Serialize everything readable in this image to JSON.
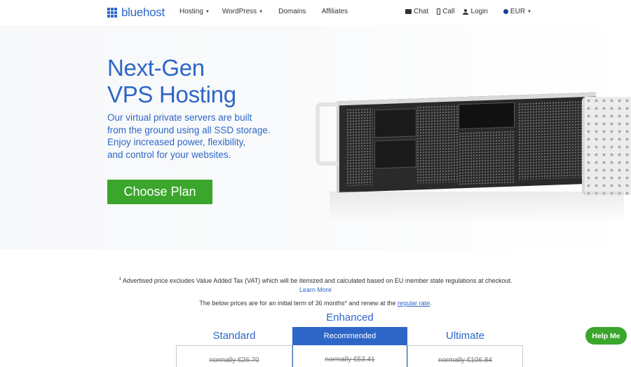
{
  "header": {
    "logo_text": "bluehost",
    "nav": [
      {
        "label": "Hosting",
        "dropdown": true
      },
      {
        "label": "WordPress",
        "dropdown": true
      },
      {
        "label": "Domains",
        "dropdown": false
      },
      {
        "label": "Affiliates",
        "dropdown": false
      }
    ],
    "right": {
      "chat": "Chat",
      "call": "Call",
      "login": "Login",
      "currency": "EUR"
    }
  },
  "hero": {
    "title_line1": "Next-Gen",
    "title_line2": "VPS Hosting",
    "subtitle_line1": "Our virtual private servers are built",
    "subtitle_line2": "from the ground using all SSD storage.",
    "subtitle_line3": "Enjoy increased power, flexibility,",
    "subtitle_line4": "and control for your websites.",
    "cta_label": "Choose Plan"
  },
  "notes": {
    "footnote_marker": "1",
    "vat_note": "Advertised price excludes Value Added Tax (VAT) which will be itemized and calculated based on EU member state regulations at checkout.",
    "learn_more": "Learn More",
    "term_note_prefix": "The below prices are for an initial term of 36 months* and renew at the",
    "regular_rate": "regular rate",
    "term_note_suffix": "."
  },
  "plans": {
    "enhanced_heading": "Enhanced",
    "recommended_label": "Recommended",
    "standard": {
      "name": "Standard",
      "old_price": "normally €26.70"
    },
    "enhanced": {
      "old_price": "normally €53.41"
    },
    "ultimate": {
      "name": "Ultimate",
      "old_price": "normally €106.84"
    }
  },
  "help_button": "Help Me",
  "colors": {
    "brand_blue": "#2e66c8",
    "cta_green": "#3aa62c"
  }
}
